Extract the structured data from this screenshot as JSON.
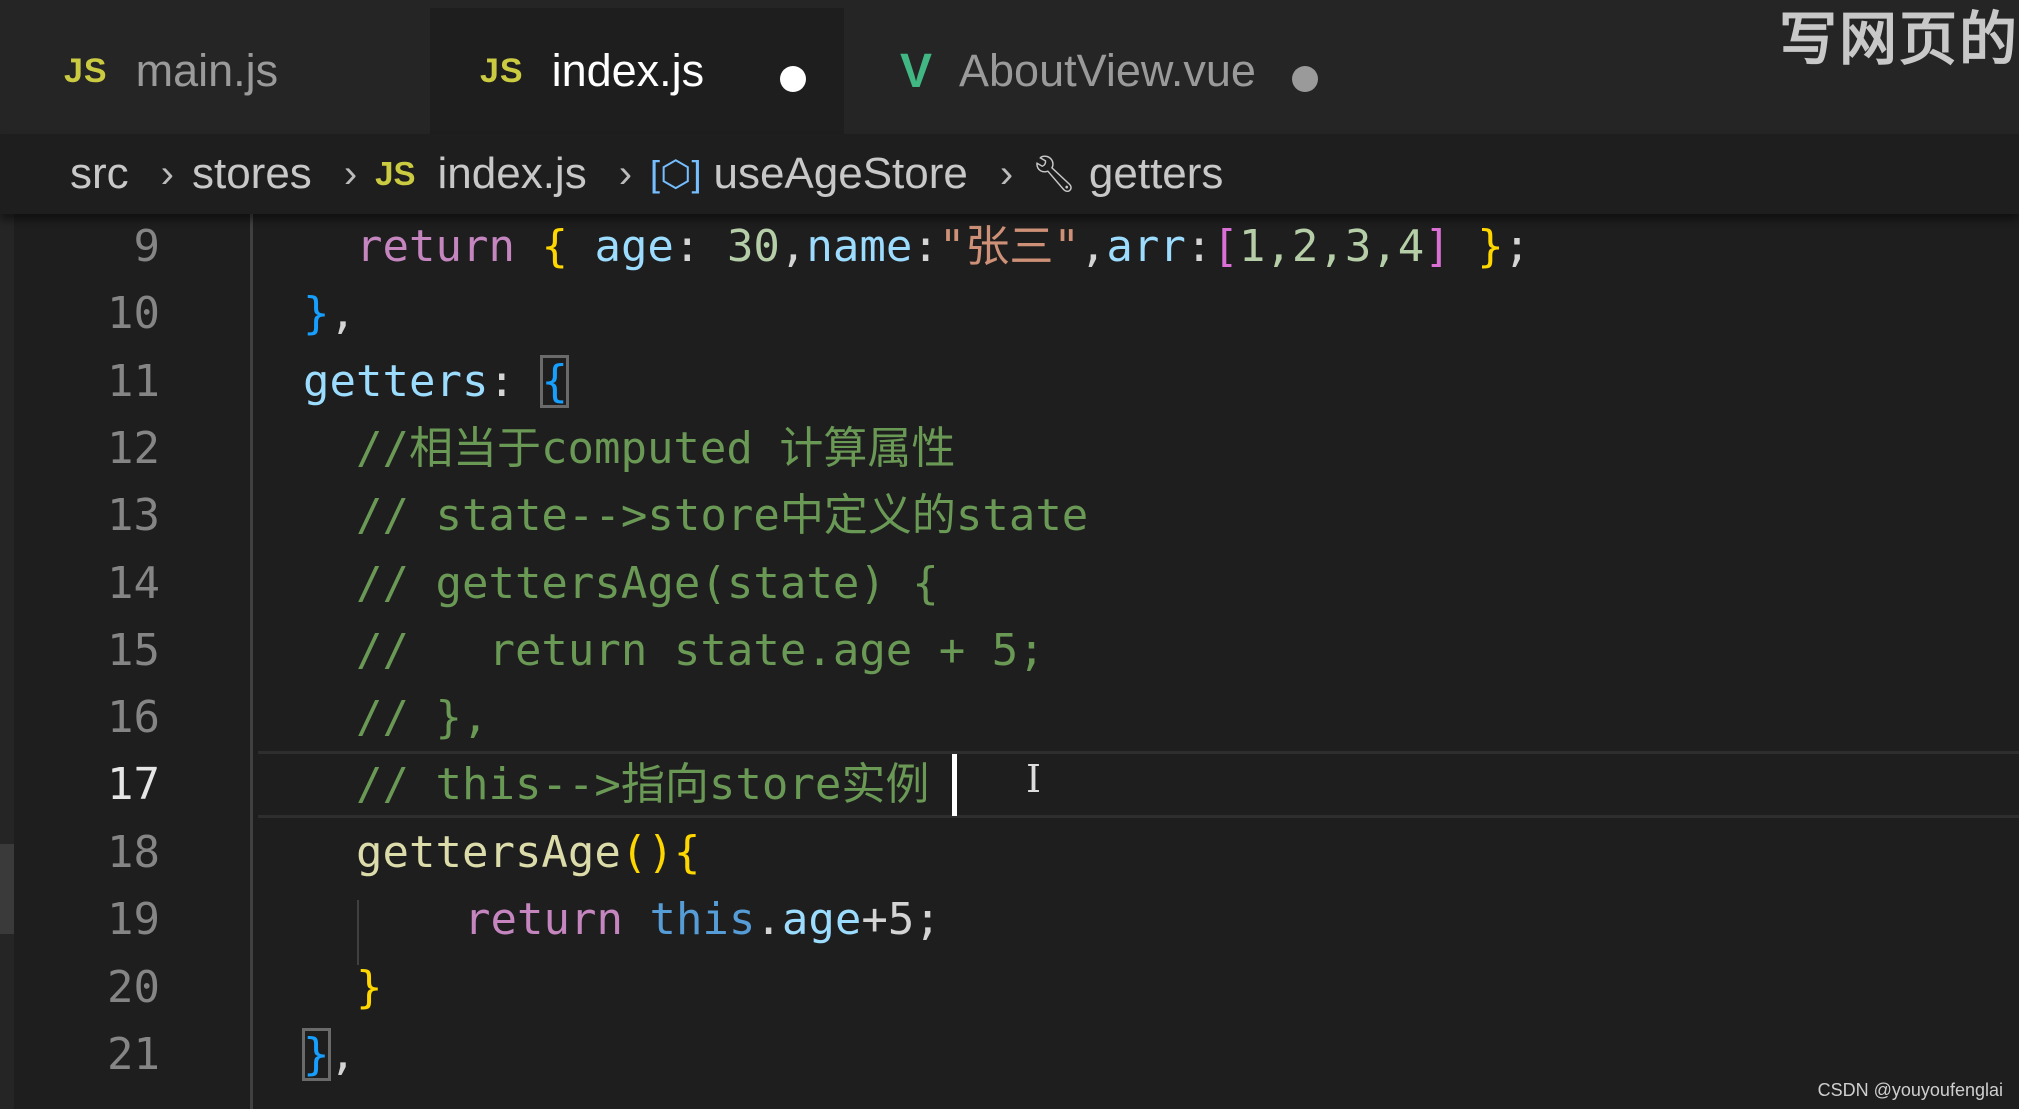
{
  "tabs": [
    {
      "icon": "JS",
      "label": "main.js",
      "active": false,
      "dirty": false
    },
    {
      "icon": "JS",
      "label": "index.js",
      "active": true,
      "dirty": true
    },
    {
      "icon": "V",
      "label": "AboutView.vue",
      "active": false,
      "dirty": true
    }
  ],
  "overlay_text": "写网页的",
  "breadcrumb": {
    "items": [
      "src",
      "stores",
      "index.js",
      "useAgeStore",
      "getters"
    ],
    "file_icon": "JS"
  },
  "editor": {
    "current_line": 17,
    "lines": [
      {
        "n": "9"
      },
      {
        "n": "10"
      },
      {
        "n": "11"
      },
      {
        "n": "12"
      },
      {
        "n": "13"
      },
      {
        "n": "14"
      },
      {
        "n": "15"
      },
      {
        "n": "16"
      },
      {
        "n": "17"
      },
      {
        "n": "18"
      },
      {
        "n": "19"
      },
      {
        "n": "20"
      },
      {
        "n": "21"
      }
    ],
    "code": {
      "l9": {
        "kw": "return",
        "open": "{",
        "key1": "age",
        "colon1": ":",
        "val1": "30",
        "comma1": ",",
        "key2": "name",
        "colon2": ":",
        "val2": "\"张三\"",
        "comma2": ",",
        "key3": "arr",
        "colon3": ":",
        "arr_open": "[",
        "arr_vals": "1,2,3,4",
        "arr_close": "]",
        "close": "}",
        "semi": ";"
      },
      "l10": {
        "close": "}",
        "comma": ","
      },
      "l11": {
        "key": "getters",
        "colon": ":",
        "open": "{"
      },
      "l12": "//相当于computed 计算属性",
      "l13": "// state-->store中定义的state",
      "l14": "// gettersAge(state) {",
      "l15": "//   return state.age + 5;",
      "l16": "// },",
      "l17": "// this-->指向store实例",
      "l18": {
        "fn": "gettersAge",
        "parens": "()",
        "open": "{"
      },
      "l19": {
        "kw": "return",
        "this": "this",
        "dot": ".",
        "prop": "age",
        "rest": "+5;"
      },
      "l20": {
        "close": "}"
      },
      "l21": {
        "close": "}",
        "comma": ","
      }
    }
  },
  "footer_watermark": "CSDN @youyoufenglai",
  "colors": {
    "background": "#1e1e1e",
    "keyword": "#c586c0",
    "property": "#9cdcfe",
    "comment": "#6a9955",
    "string": "#ce9178",
    "number": "#b5cea8",
    "function": "#dcdcaa",
    "js_icon": "#cbcb41",
    "vue_icon": "#41b883"
  }
}
